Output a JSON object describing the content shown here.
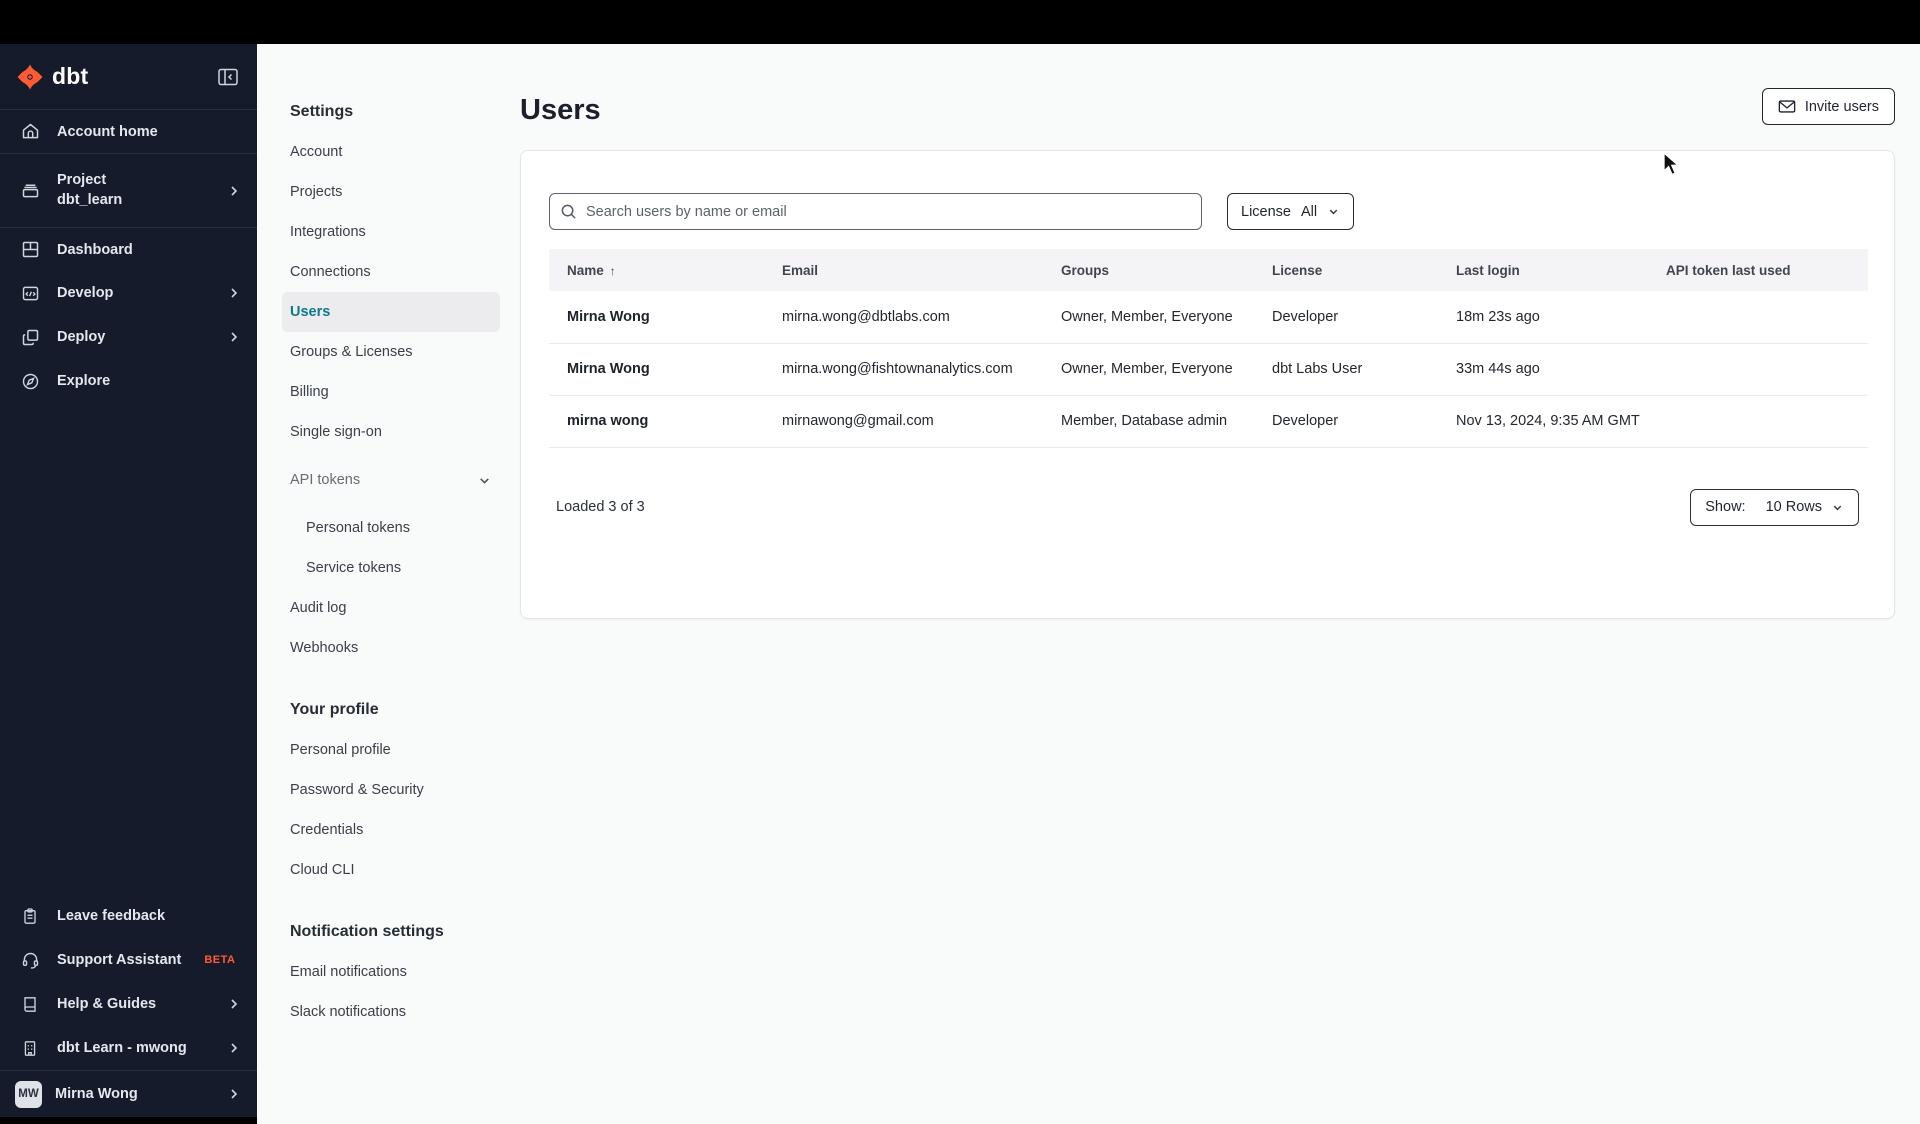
{
  "sidebar": {
    "logo_text": "dbt",
    "nav": [
      {
        "label": "Account home"
      },
      {
        "label": "Project",
        "sublabel": "dbt_learn"
      },
      {
        "label": "Dashboard"
      },
      {
        "label": "Develop"
      },
      {
        "label": "Deploy"
      },
      {
        "label": "Explore"
      }
    ],
    "footer_nav": [
      {
        "label": "Leave feedback"
      },
      {
        "label": "Support Assistant",
        "badge": "BETA"
      },
      {
        "label": "Help & Guides"
      },
      {
        "label": "dbt Learn - mwong"
      }
    ],
    "user": {
      "initials": "MW",
      "name": "Mirna Wong"
    }
  },
  "settings_nav": {
    "title": "Settings",
    "items": [
      "Account",
      "Projects",
      "Integrations",
      "Connections",
      "Users",
      "Groups & Licenses",
      "Billing",
      "Single sign-on"
    ],
    "api_tokens_label": "API tokens",
    "api_token_items": [
      "Personal tokens",
      "Service tokens"
    ],
    "items2": [
      "Audit log",
      "Webhooks"
    ],
    "profile_title": "Your profile",
    "profile_items": [
      "Personal profile",
      "Password & Security",
      "Credentials",
      "Cloud CLI"
    ],
    "notifications_title": "Notification settings",
    "notification_items": [
      "Email notifications",
      "Slack notifications"
    ]
  },
  "main": {
    "title": "Users",
    "invite_button_label": "Invite users",
    "search_placeholder": "Search users by name or email",
    "license_filter": {
      "label": "License",
      "value": "All"
    },
    "table": {
      "headers": [
        "Name",
        "Email",
        "Groups",
        "License",
        "Last login",
        "API token last used"
      ],
      "sort_indicator": "↑",
      "rows": [
        {
          "name": "Mirna Wong",
          "email": "mirna.wong@dbtlabs.com",
          "groups": "Owner, Member, Everyone",
          "license": "Developer",
          "last_login": "18m 23s ago",
          "api_token_last_used": ""
        },
        {
          "name": "Mirna Wong",
          "email": "mirna.wong@fishtownanalytics.com",
          "groups": "Owner, Member, Everyone",
          "license": "dbt Labs User",
          "last_login": "33m 44s ago",
          "api_token_last_used": ""
        },
        {
          "name": "mirna wong",
          "email": "mirnawong@gmail.com",
          "groups": "Member, Database admin",
          "license": "Developer",
          "last_login": "Nov 13, 2024, 9:35 AM GMT",
          "api_token_last_used": ""
        }
      ]
    },
    "footer": {
      "loaded_text": "Loaded 3 of 3",
      "show_label": "Show:",
      "show_value": "10 Rows"
    }
  },
  "colors": {
    "accent_orange": "#ff5c35",
    "active_teal": "#0e7987",
    "sidebar_bg": "#151b2a"
  }
}
